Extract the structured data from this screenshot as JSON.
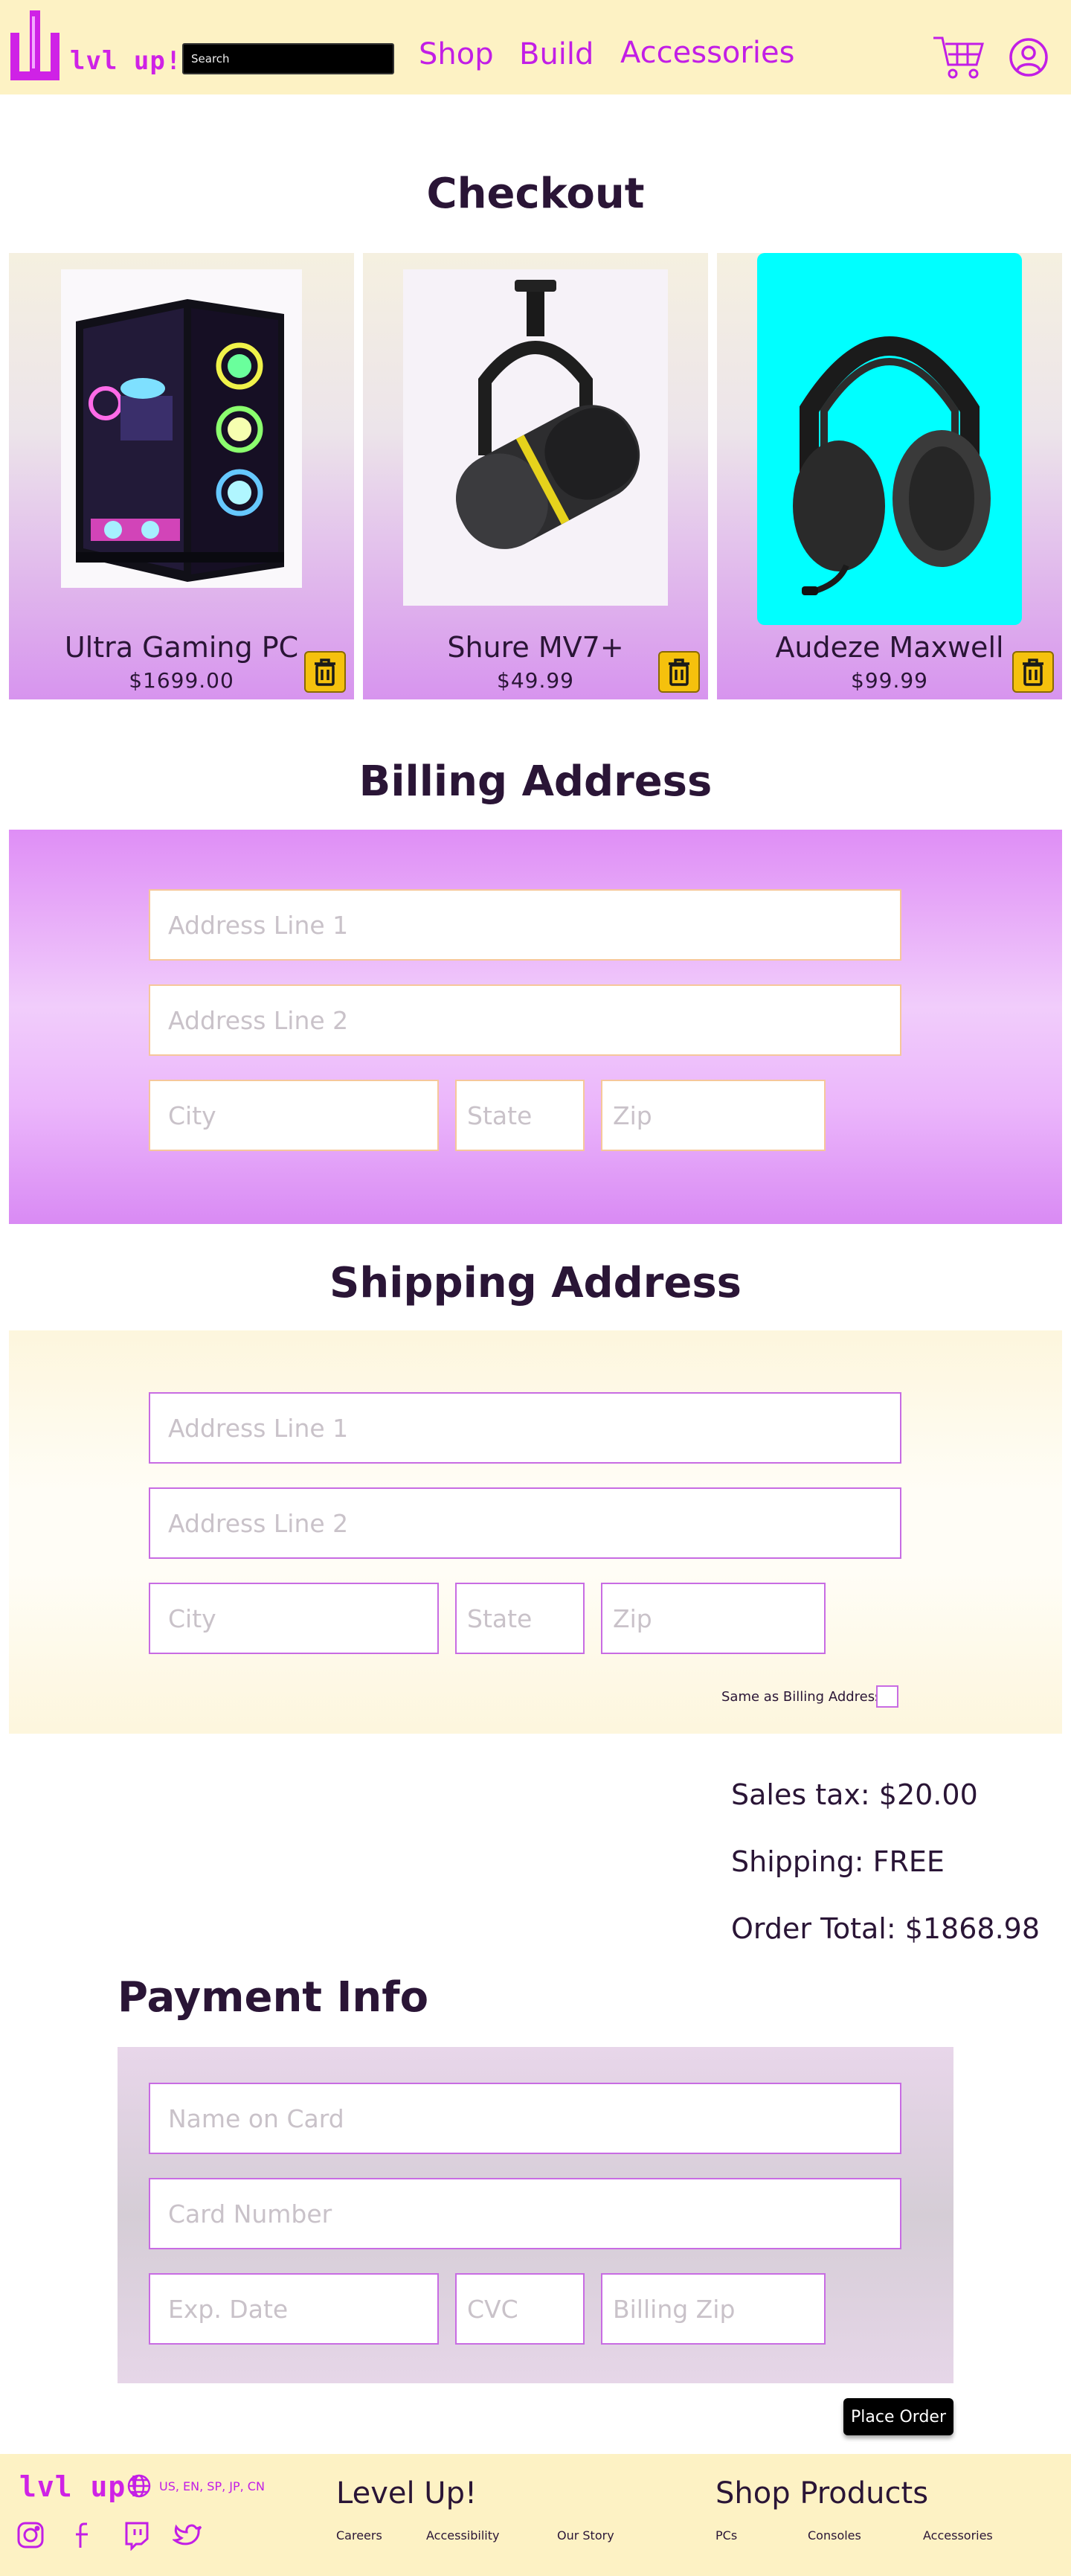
{
  "colors": {
    "brand": "#c21ee6",
    "header_bg": "#fdf2c4",
    "trash": "#f5c10d"
  },
  "header": {
    "logo_text": "lvl up!",
    "search_placeholder": "Search",
    "nav": [
      "Shop",
      "Build",
      "Accessories"
    ],
    "icons": [
      "cart-icon",
      "user-icon"
    ]
  },
  "checkout": {
    "title": "Checkout",
    "products": [
      {
        "name": "Ultra Gaming PC",
        "price": "$1699.00"
      },
      {
        "name": "Shure MV7+",
        "price": "$49.99"
      },
      {
        "name": "Audeze Maxwell",
        "price": "$99.99"
      }
    ]
  },
  "billing": {
    "title": "Billing Address",
    "address1": "Address Line 1",
    "address2": "Address Line 2",
    "city": "City",
    "state": "State",
    "zip": "Zip"
  },
  "shipping": {
    "title": "Shipping Address",
    "address1": "Address Line 1",
    "address2": "Address Line 2",
    "city": "City",
    "state": "State",
    "zip": "Zip",
    "same_label": "Same as Billing Address"
  },
  "summary": {
    "tax": "Sales tax: $20.00",
    "shipping": "Shipping: FREE",
    "total": "Order Total: $1868.98"
  },
  "payment": {
    "title": "Payment Info",
    "name": "Name on Card",
    "number": "Card Number",
    "exp": "Exp. Date",
    "cvc": "CVC",
    "zip": "Billing Zip",
    "place_order": "Place Order"
  },
  "footer": {
    "logo_text": "lvl up!",
    "languages": "US, EN, SP, JP, CN",
    "social_icons": [
      "instagram-icon",
      "facebook-icon",
      "twitch-icon",
      "twitter-icon"
    ],
    "company_heading": "Level Up!",
    "company_links": [
      "Careers",
      "Accessibility",
      "Our Story"
    ],
    "products_heading": "Shop Products",
    "product_links": [
      "PCs",
      "Consoles",
      "Accessories"
    ]
  }
}
